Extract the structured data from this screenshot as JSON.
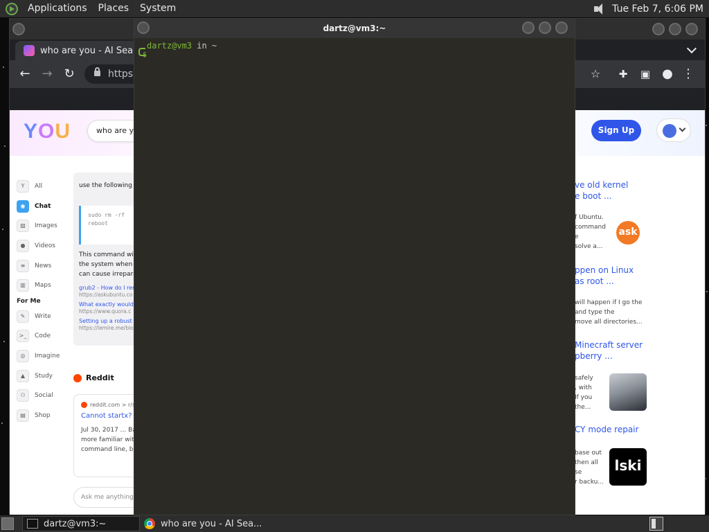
{
  "top_panel": {
    "menus": [
      "Applications",
      "Places",
      "System"
    ],
    "clock": "Tue Feb  7,  6:06 PM"
  },
  "browser": {
    "tab_title": "who are you - AI Search",
    "address": "https:",
    "page": {
      "logo": "YOU",
      "search_value": "who are you",
      "signup_label": "Sign Up",
      "sidebar": {
        "items": [
          {
            "label": "All",
            "icon": "you-icon"
          },
          {
            "label": "Chat",
            "icon": "chat-icon"
          },
          {
            "label": "Images",
            "icon": "image-icon"
          },
          {
            "label": "Videos",
            "icon": "video-icon"
          },
          {
            "label": "News",
            "icon": "news-icon"
          },
          {
            "label": "Maps",
            "icon": "map-icon"
          }
        ],
        "for_me_heading": "For Me",
        "for_me_items": [
          {
            "label": "Write",
            "icon": "pen-icon"
          },
          {
            "label": "Code",
            "icon": "terminal-icon"
          },
          {
            "label": "Imagine",
            "icon": "spiral-icon"
          },
          {
            "label": "Study",
            "icon": "graduation-icon"
          },
          {
            "label": "Social",
            "icon": "people-icon"
          },
          {
            "label": "Shop",
            "icon": "bag-icon"
          }
        ]
      },
      "chat": {
        "intro": "use the following c",
        "code_lines": [
          "sudo rm -rf",
          "reboot"
        ],
        "para_lines": [
          "This command wil",
          "the system when t",
          "can cause irrepara"
        ],
        "sources": [
          {
            "title": "grub2 - How do I rem",
            "url": "https://askubuntu.co"
          },
          {
            "title": "What exactly would h",
            "url": "https://www.quora.c"
          },
          {
            "title": "Setting up a robust M",
            "url": "https://lemire.me/blo"
          }
        ]
      },
      "reddit": {
        "heading": "Reddit",
        "source": "reddit.com > r/s",
        "title": "Cannot startx? :",
        "snippet_lines": [
          "Jul 30, 2017 ... Ba",
          "more familiar with",
          "command line, bu"
        ]
      },
      "ask_placeholder": "Ask me anything...",
      "results": [
        {
          "title_lines": [
            "ve old kernel",
            "e boot ..."
          ],
          "snippet_lines": [
            "f Ubuntu.",
            "command",
            "e",
            "solve a..."
          ],
          "thumb": "ask"
        },
        {
          "title_lines": [
            "ppen on Linux",
            "as root ..."
          ],
          "snippet_lines": [
            "will happen if I go the",
            "and type the",
            "move all directories..."
          ]
        },
        {
          "title_lines": [
            "Minecraft server",
            "pberry ..."
          ],
          "snippet_lines": [
            "safely",
            ", with",
            "If you",
            "the..."
          ]
        },
        {
          "title_lines": [
            "CY mode repair"
          ],
          "snippet_lines": [
            "base out",
            "then all",
            "se",
            "r backu..."
          ],
          "thumb": "lski"
        }
      ]
    }
  },
  "terminal": {
    "title": "dartz@vm3:~",
    "prompt_user": "dartz@vm3",
    "prompt_rest": " in ~",
    "prompt_symbol": "$"
  },
  "taskbar": {
    "items": [
      "dartz@vm3:~",
      "who are you - AI Sea..."
    ]
  }
}
